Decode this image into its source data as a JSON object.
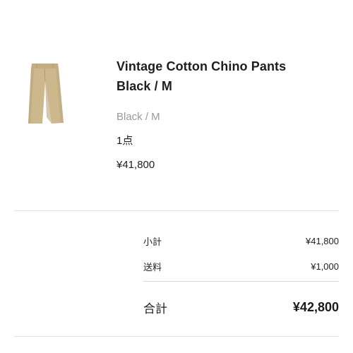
{
  "product": {
    "name_line1": "Vintage Cotton Chino Pants",
    "name_line2": "Black / M",
    "variant": "Black / M",
    "quantity": "1点",
    "price": "¥41,800",
    "image_icon": "chino-pants-thumbnail"
  },
  "summary": {
    "subtotal_label": "小計",
    "subtotal_value": "¥41,800",
    "shipping_label": "送料",
    "shipping_value": "¥1,000",
    "total_label": "合計",
    "total_value": "¥42,800"
  },
  "colors": {
    "pants": "#c9b48a",
    "muted_text": "#9a9a9a",
    "divider": "#e2e2e2"
  }
}
